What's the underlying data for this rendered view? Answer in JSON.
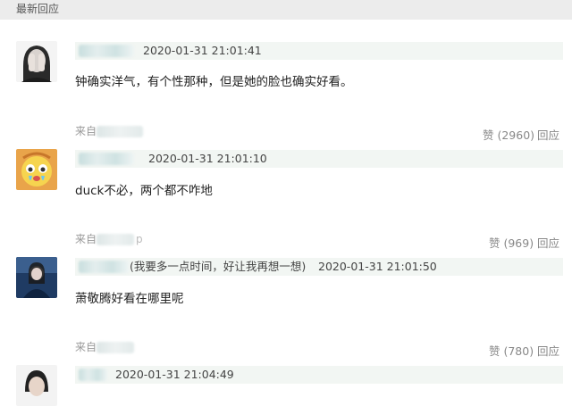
{
  "section": {
    "title": "最新回应"
  },
  "comments": [
    {
      "timestamp": "2020-01-31 21:01:41",
      "text": "钟确实洋气，有个性那种，但是她的脸也确实好看。",
      "source_prefix": "来自",
      "likes": "赞 (2960)",
      "reply": "回应",
      "avatar": "woman-hiding-face-avatar"
    },
    {
      "timestamp": "2020-01-31 21:01:10",
      "text": "duck不必，两个都不咋地",
      "source_prefix": "来自",
      "source_tail": "p",
      "likes": "赞 (969)",
      "reply": "回应",
      "avatar": "crying-cartoon-avatar"
    },
    {
      "note": "(我要多一点时间，好让我再想一想)",
      "timestamp": "2020-01-31 21:01:50",
      "text": "萧敬腾好看在哪里呢",
      "source_prefix": "来自",
      "likes": "赞 (780)",
      "reply": "回应",
      "avatar": "blue-portrait-avatar"
    },
    {
      "timestamp": "2020-01-31 21:04:49",
      "avatar": "dark-hair-avatar"
    }
  ],
  "colors": {
    "header_strip": "#f2f6f3",
    "section_bar": "#ececec"
  }
}
